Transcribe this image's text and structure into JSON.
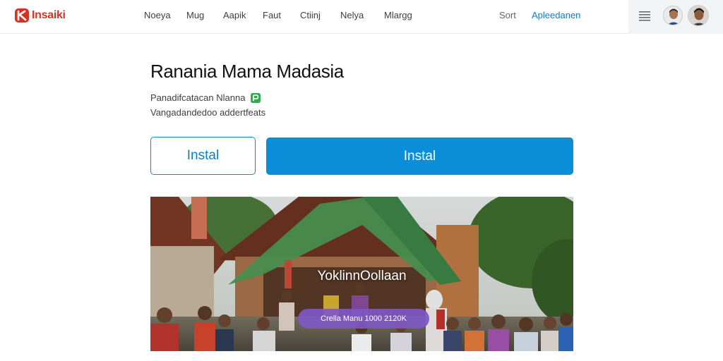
{
  "header": {
    "logo_text": "Insaiki",
    "nav": [
      "Noeya",
      "Mug",
      "Aapik",
      "Faut",
      "Ctiinj",
      "Nelya",
      "Mlargg"
    ],
    "sort_label": "Sort",
    "account_link": "Apleedanen"
  },
  "app": {
    "title": "Ranania Mama Madasia",
    "developer": "Panadifcatacan Nlanna",
    "subtitle": "Vangadandedoo addertfeats",
    "install_outline_label": "Instal",
    "install_primary_label": "Instal"
  },
  "banner": {
    "title": "YoklinnOollaan",
    "pill_text": "Crella Manu 1000 2120K"
  },
  "colors": {
    "brand_red": "#d93025",
    "accent_blue": "#0a8ed8",
    "link_blue": "#0b7fb8",
    "verified_green": "#34a853",
    "pill_purple": "#7e58c4"
  },
  "icons": {
    "logo": "brand-logo-icon",
    "menu": "menu-icon",
    "verified": "verified-badge-icon"
  }
}
